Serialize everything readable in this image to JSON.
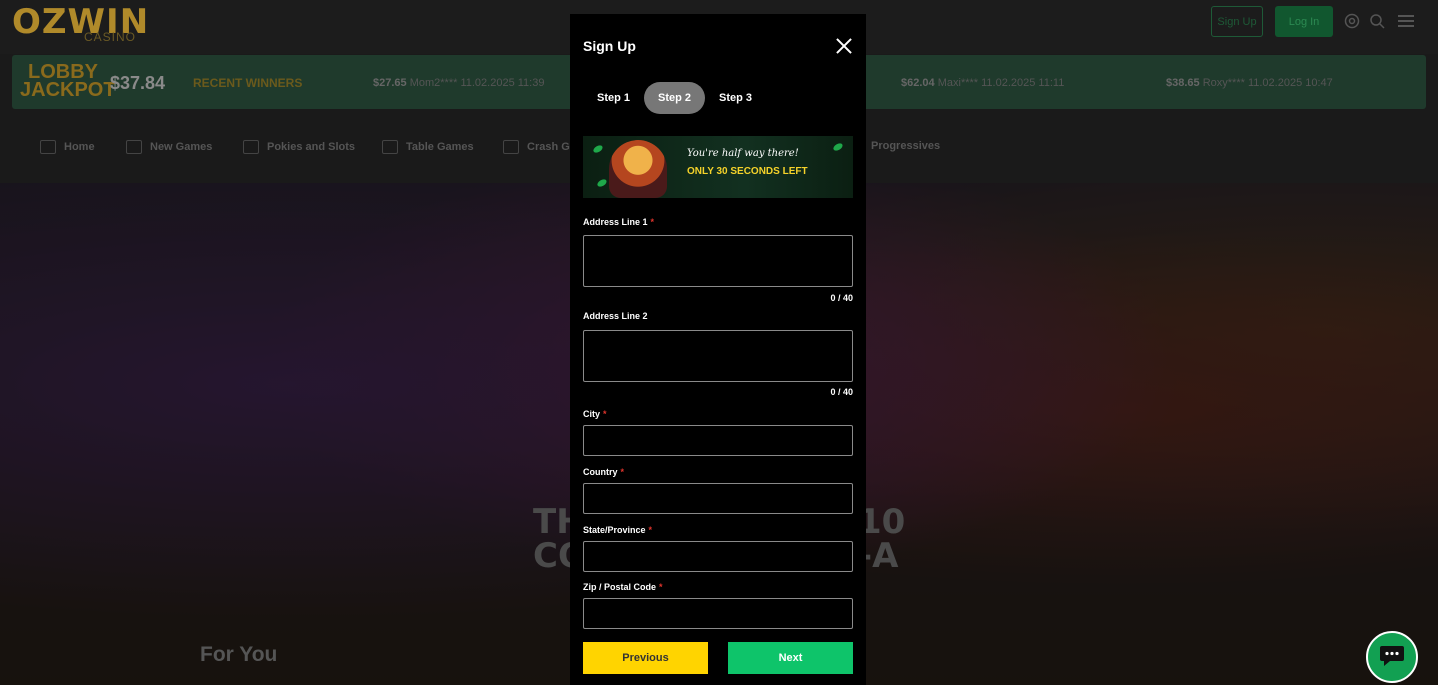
{
  "site": {
    "logo_text": "OZWIN",
    "logo_sub": "CASINO",
    "signup_label": "Sign Up",
    "login_label": "Log In"
  },
  "ticker": {
    "jackpot_logo": "LOBBY JACKPOT",
    "jackpot_amount": "$37.84",
    "recent_label": "RECENT WINNERS",
    "items": [
      {
        "amount": "$27.65",
        "text": "Mom2**** 11.02.2025 11:39"
      },
      {
        "amount": "$62.04",
        "text": "Maxi**** 11.02.2025 11:11"
      },
      {
        "amount": "$38.65",
        "text": "Roxy**** 11.02.2025 10:47"
      }
    ]
  },
  "nav": {
    "items": [
      {
        "label": "Home"
      },
      {
        "label": "New Games"
      },
      {
        "label": "Pokies and Slots"
      },
      {
        "label": "Table Games"
      },
      {
        "label": "Crash Ga"
      },
      {
        "label": "Progressives"
      }
    ]
  },
  "hero": {
    "line1": "TH",
    "line2": "CO",
    "right1": "10",
    "right2": "-A",
    "for_you": "For You"
  },
  "modal": {
    "title": "Sign Up",
    "steps": [
      {
        "label": "Step 1",
        "active": false
      },
      {
        "label": "Step 2",
        "active": true
      },
      {
        "label": "Step 3",
        "active": false
      }
    ],
    "banner": {
      "line1": "You're half way there!",
      "line2": "ONLY 30 SECONDS LEFT"
    },
    "fields": {
      "address1": {
        "label": "Address Line 1",
        "value": "",
        "counter": "0 / 40"
      },
      "address2": {
        "label": "Address Line 2",
        "value": "",
        "counter": "0 / 40"
      },
      "city": {
        "label": "City",
        "value": ""
      },
      "country": {
        "label": "Country",
        "value": ""
      },
      "state": {
        "label": "State/Province",
        "value": ""
      },
      "zip": {
        "label": "Zip / Postal Code",
        "value": ""
      }
    },
    "required_mark": "*",
    "previous_label": "Previous",
    "next_label": "Next"
  },
  "colors": {
    "primary_green": "#0ec46a",
    "accent_yellow": "#ffd400",
    "required_red": "#e0342c"
  }
}
